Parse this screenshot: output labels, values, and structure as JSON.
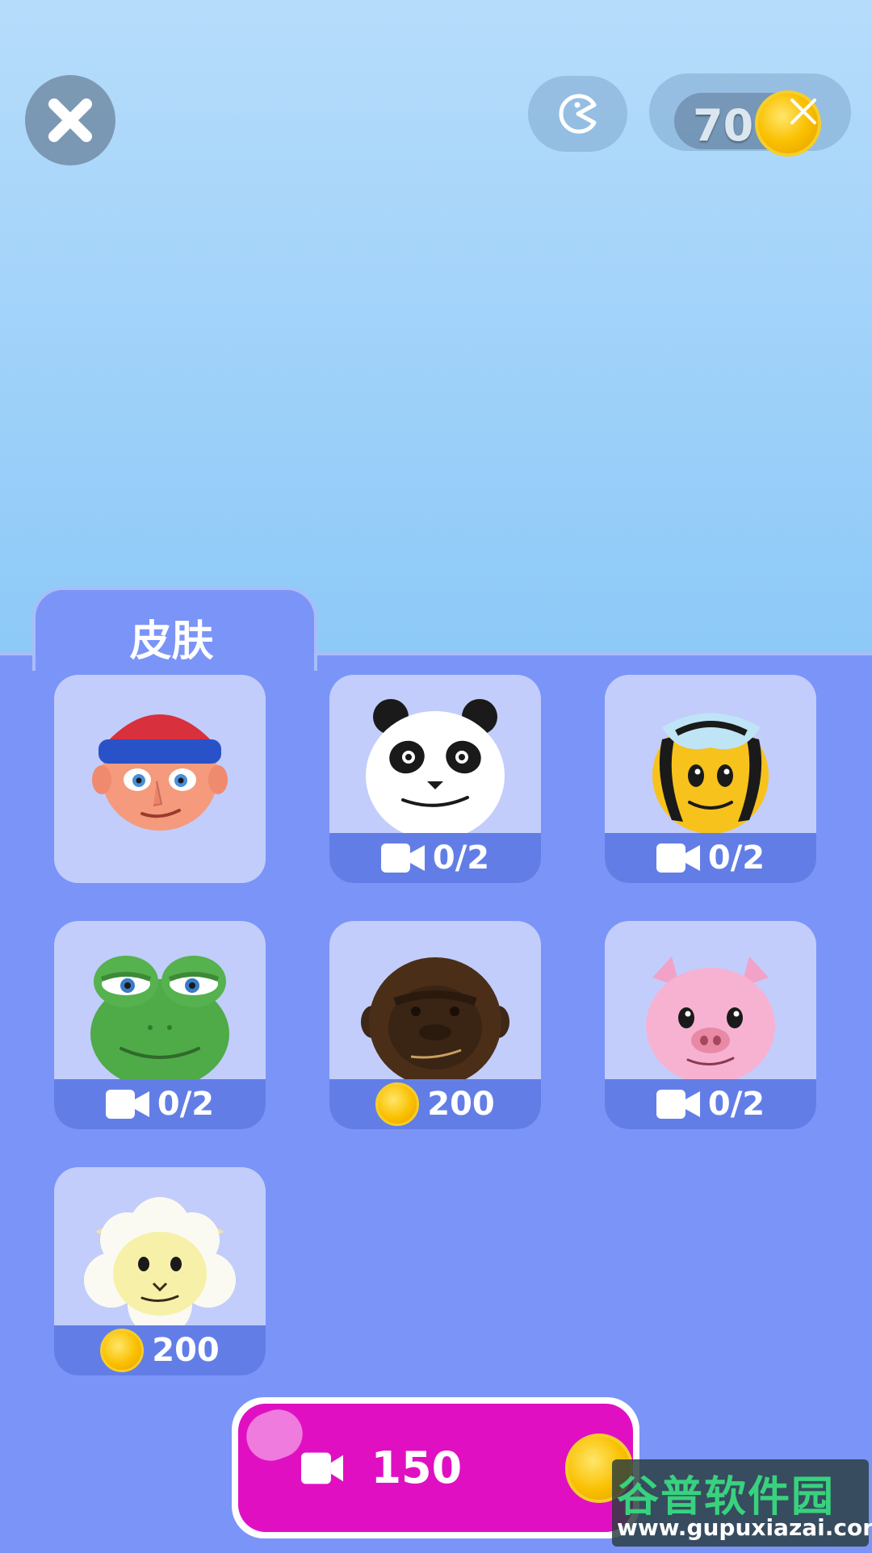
{
  "header": {
    "coin_balance": "70"
  },
  "tab": {
    "label": "皮肤"
  },
  "skins": [
    {
      "name": "boy-beanie",
      "selected": true,
      "price_type": "none",
      "price_label": ""
    },
    {
      "name": "panda",
      "price_type": "video",
      "price_label": "0/2"
    },
    {
      "name": "bee",
      "price_type": "video",
      "price_label": "0/2"
    },
    {
      "name": "frog",
      "price_type": "video",
      "price_label": "0/2"
    },
    {
      "name": "gorilla",
      "price_type": "coin",
      "price_label": "200"
    },
    {
      "name": "pig",
      "price_type": "video",
      "price_label": "0/2"
    },
    {
      "name": "sheep",
      "price_type": "coin",
      "price_label": "200"
    }
  ],
  "cta": {
    "label": "150"
  },
  "watermark": {
    "title": "谷普软件园",
    "url": "www.gupuxiazai.com"
  },
  "colors": {
    "panel": "#7b94f7",
    "card": "#c2cdfb",
    "card_footer": "#627ee6",
    "cta": "#e010c2",
    "coin": "#fac000"
  }
}
